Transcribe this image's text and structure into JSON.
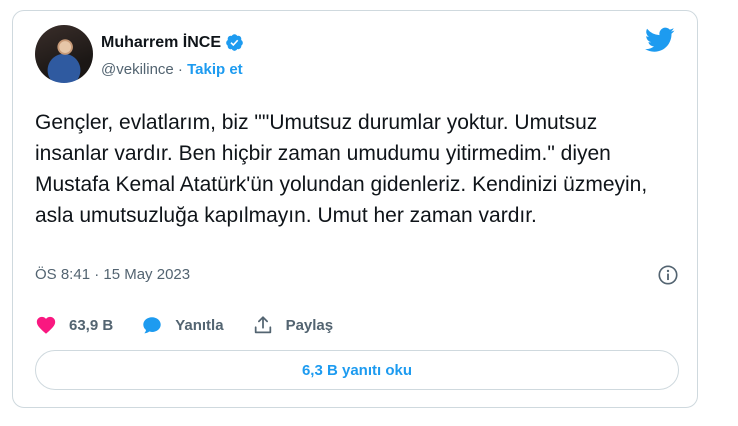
{
  "author": {
    "name": "Muharrem İNCE",
    "handle": "@vekilince",
    "separator": " · ",
    "follow_label": "Takip et"
  },
  "tweet": {
    "text": "Gençler, evlatlarım, biz \"\"Umutsuz durumlar yoktur. Umutsuz insanlar vardır. Ben hiçbir zaman umudumu yitirmedim.\" diyen Mustafa Kemal Atatürk'ün yolundan gidenleriz. Kendinizi üzmeyin, asla umutsuzluğa kapılmayın. Umut her zaman vardır.",
    "timestamp": "ÖS 8:41 · 15 May 2023"
  },
  "actions": {
    "like_count": "63,9 B",
    "reply_label": "Yanıtla",
    "share_label": "Paylaş"
  },
  "replies_button": {
    "label": "6,3 B yanıtı oku"
  },
  "colors": {
    "accent": "#1d9bf0",
    "like": "#f91880",
    "secondary_text": "#536471",
    "border": "#cfd9de"
  },
  "icons": [
    "verified-badge-icon",
    "twitter-bird-icon",
    "info-icon",
    "heart-icon",
    "reply-bubble-icon",
    "share-icon"
  ]
}
